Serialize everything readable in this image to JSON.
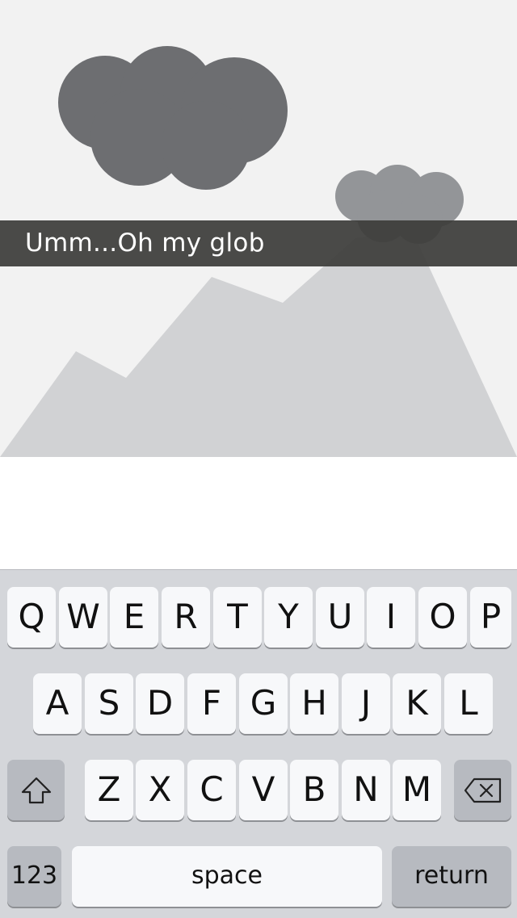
{
  "caption": {
    "text": "Umm...Oh my glob"
  },
  "keyboard": {
    "row1": [
      "Q",
      "W",
      "E",
      "R",
      "T",
      "Y",
      "U",
      "I",
      "O",
      "P"
    ],
    "row2": [
      "A",
      "S",
      "D",
      "F",
      "G",
      "H",
      "J",
      "K",
      "L"
    ],
    "row3": [
      "Z",
      "X",
      "C",
      "V",
      "B",
      "N",
      "M"
    ],
    "shift_icon": "shift-arrow-icon",
    "delete_icon": "backspace-icon",
    "numbers_label": "123",
    "space_label": "space",
    "return_label": "return"
  },
  "colors": {
    "photo_background": "#f2f2f2",
    "cloud_dark": "#6d6e71",
    "cloud_light": "#939598",
    "mountain": "#d1d2d4",
    "caption_bar": "#3c3c3a",
    "keyboard_background": "#d4d6da",
    "key_light": "#f7f8fa",
    "key_dark": "#b7bac0"
  }
}
